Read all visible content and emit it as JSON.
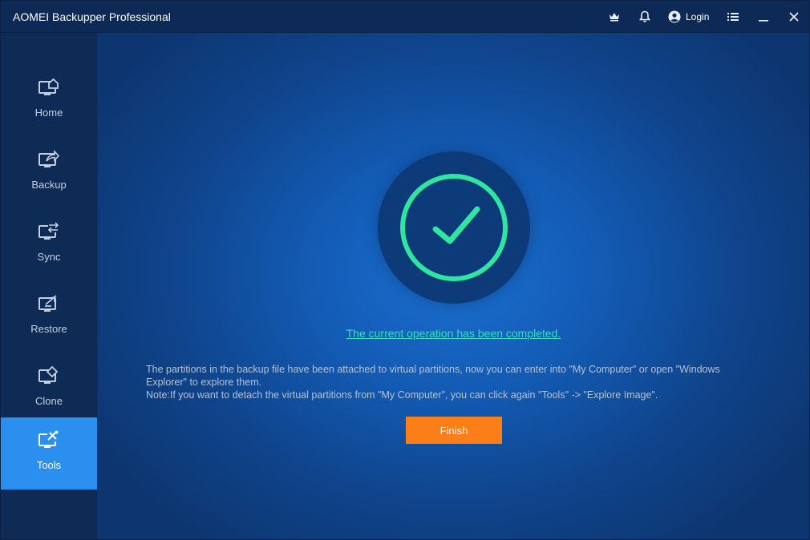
{
  "app": {
    "title": "AOMEI Backupper Professional"
  },
  "titlebar": {
    "login_label": "Login",
    "icons": [
      "crown-icon",
      "bell-icon",
      "user-icon",
      "menu-icon",
      "minimize-icon",
      "close-icon"
    ]
  },
  "sidebar": {
    "items": [
      {
        "label": "Home",
        "icon": "home-icon"
      },
      {
        "label": "Backup",
        "icon": "backup-icon"
      },
      {
        "label": "Sync",
        "icon": "sync-icon"
      },
      {
        "label": "Restore",
        "icon": "restore-icon"
      },
      {
        "label": "Clone",
        "icon": "clone-icon"
      },
      {
        "label": "Tools",
        "icon": "tools-icon",
        "active": true
      }
    ]
  },
  "main": {
    "status_icon": "checkmark-icon",
    "completed_text": "The current operation has been completed.",
    "desc_line1": "The partitions in the backup file have been attached to virtual partitions, now you can enter into \"My Computer\" or open \"Windows Explorer\" to explore them.",
    "desc_line2": "Note:If you want to detach the virtual partitions from \"My Computer\", you can click again \"Tools\" -> \"Explore Image\".",
    "finish_label": "Finish"
  },
  "colors": {
    "accent": "#2b8ff0",
    "success": "#2fe6a0",
    "link": "#33e0b5",
    "button": "#fb7e18",
    "titlebar": "#0c2a55"
  }
}
